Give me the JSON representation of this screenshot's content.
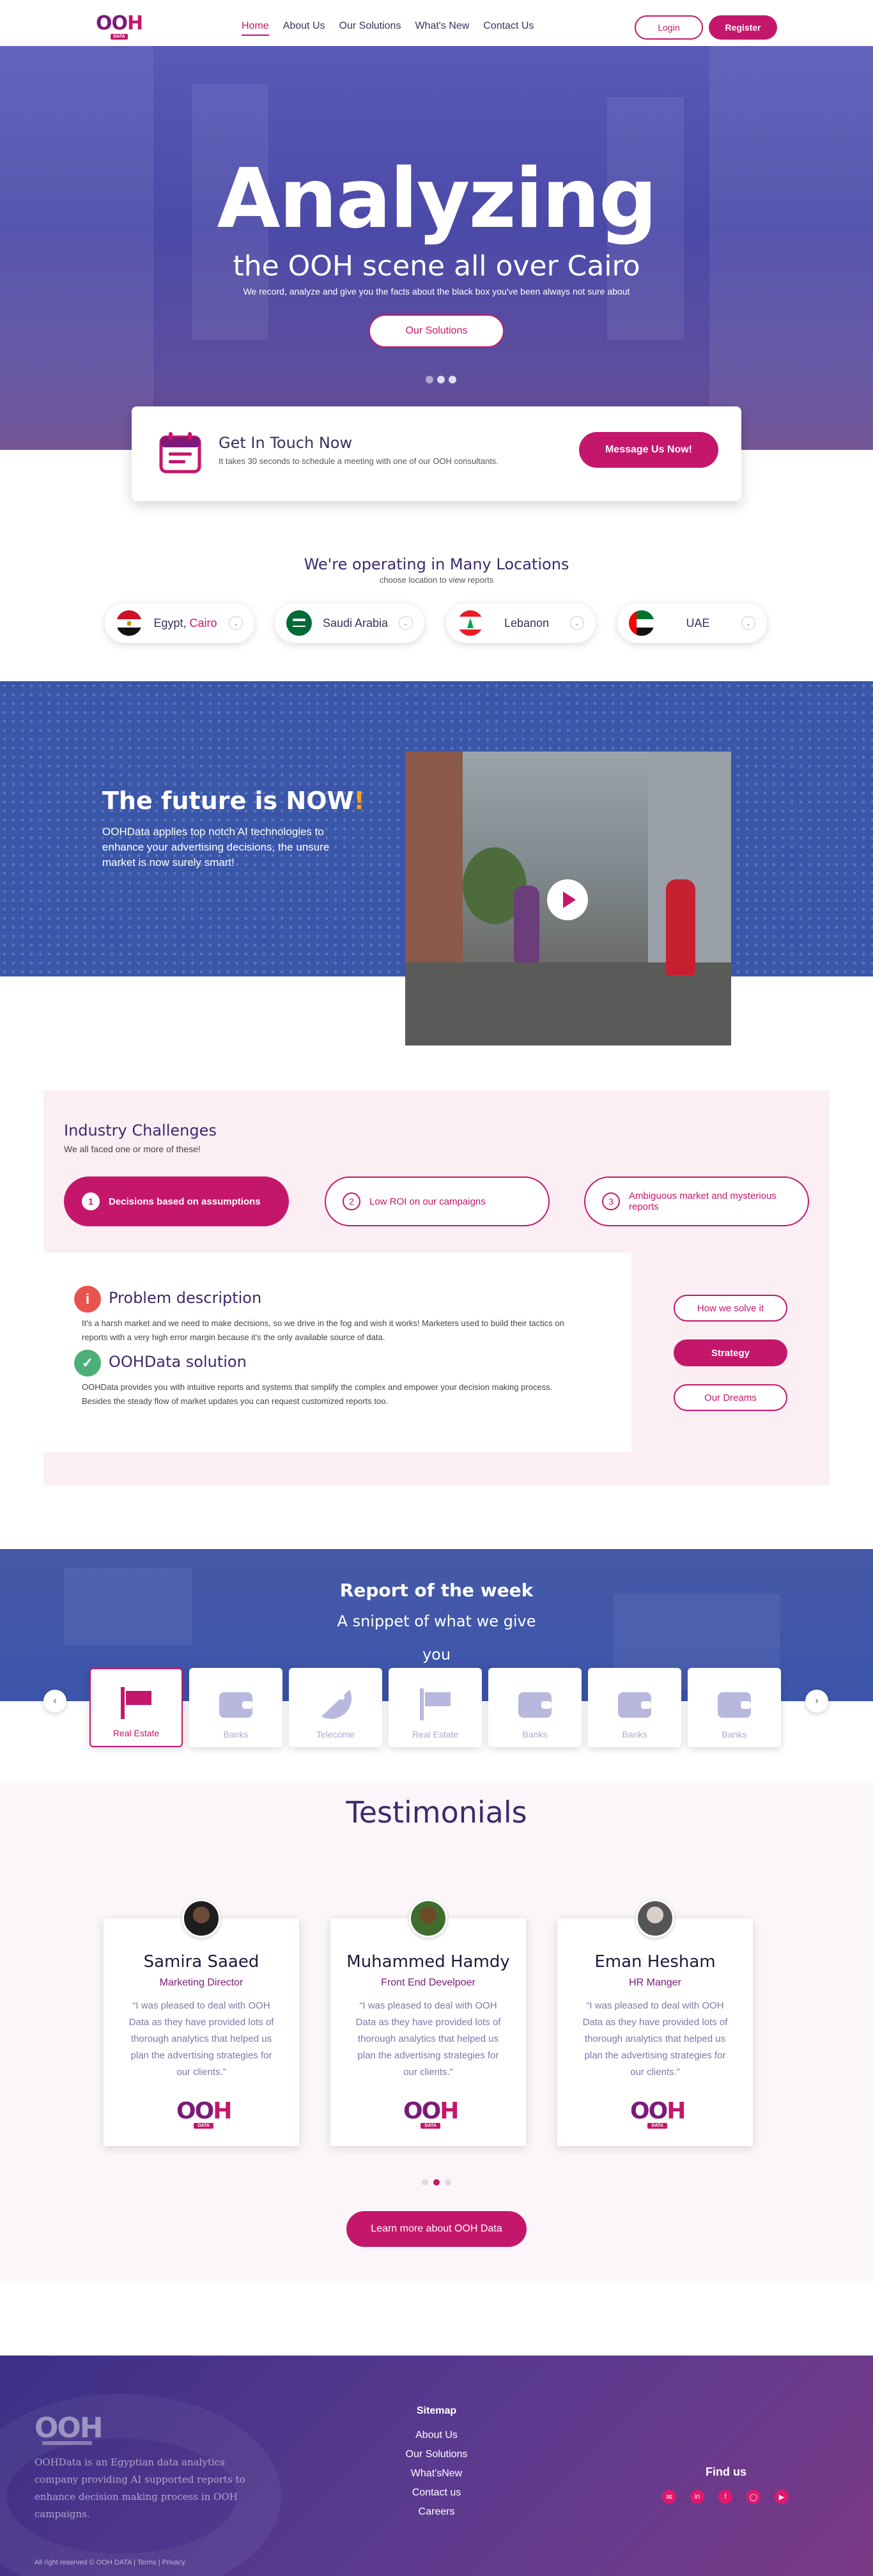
{
  "nav": {
    "logo_main": "OOH",
    "logo_sub": "DATA",
    "items": [
      "Home",
      "About Us",
      "Our Solutions",
      "What's New",
      "Contact Us"
    ],
    "active_index": 0,
    "login": "Login",
    "register": "Register"
  },
  "hero": {
    "title": "Analyzing",
    "subtitle": "the OOH scene all over Cairo",
    "text": "We record, analyze and give you the facts about the black box you've been always not sure about",
    "cta": "Our Solutions"
  },
  "touch": {
    "title": "Get In Touch Now",
    "text": "It takes 30 seconds to schedule a meeting with one of our OOH consultants.",
    "button": "Message Us Now!",
    "icon": "calendar-icon"
  },
  "locations": {
    "title": "We're operating in Many Locations",
    "subtitle": "choose location to view reports",
    "items": [
      {
        "label": "Egypt,",
        "city": "Cairo"
      },
      {
        "label": "Saudi Arabia",
        "city": ""
      },
      {
        "label": "Lebanon",
        "city": ""
      },
      {
        "label": "UAE",
        "city": ""
      }
    ]
  },
  "future": {
    "title": "The future is NOW",
    "exclaim": "!",
    "text": "OOHData applies top notch AI technologies to enhance your advertising decisions, the unsure market is now surely smart!"
  },
  "challenges": {
    "title": "Industry Challenges",
    "subtitle": "We all faced one or more of these!",
    "pills": [
      {
        "num": "1",
        "label": "Decisions based on assumptions"
      },
      {
        "num": "2",
        "label": "Low ROI on our campaigns"
      },
      {
        "num": "3",
        "label": "Ambiguous market and mysterious reports"
      }
    ],
    "problem_title": "Problem description",
    "problem_text": "It's a harsh market and we need to make decisions, so we drive in the fog and wish it works! Marketers used to build their tactics on reports with a very high error margin because it's the only available source of data.",
    "solution_title": "OOHData solution",
    "solution_text": "OOHData provides you with intuitive reports and systems that simplify the complex and empower your decision making process. Besides the steady flow of market updates you can request customized reports too.",
    "side_buttons": [
      "How we solve it",
      "Strategy",
      "Our Dreams"
    ]
  },
  "report": {
    "title": "Report of the week",
    "snippet": "A snippet of what we give",
    "snippet2": "you",
    "cards": [
      "Real Estate",
      "Banks",
      "Telecome",
      "Real Estate",
      "Banks",
      "Banks",
      "Banks"
    ]
  },
  "testimonials": {
    "title": "Testimonials",
    "items": [
      {
        "name": "Samira Saaed",
        "role": "Marketing Director",
        "quote": "“I was pleased to deal with OOH Data as they have provided lots of thorough analytics that helped us plan the advertising strategies for our clients.”"
      },
      {
        "name": "Muhammed Hamdy",
        "role": "Front End Develpoer",
        "quote": "“I was pleased to deal with OOH Data as they have provided lots of thorough analytics that helped us plan the advertising strategies for our clients.”"
      },
      {
        "name": "Eman Hesham",
        "role": "HR Manger",
        "quote": "“I was pleased to deal with OOH Data as they have provided lots of thorough analytics that helped us plan the advertising strategies for our clients.”"
      }
    ],
    "logo_main": "OOH",
    "logo_sub": "DATA",
    "learn": "Learn more about OOH Data"
  },
  "footer": {
    "logo": "OOH",
    "desc": "OOHData is an Egyptian data analytics company providing AI supported reports to enhance decision making process in OOH campaigns.",
    "copyright": "All right reserved © OOH DATA | Terms | Privacy",
    "sitemap_title": "Sitemap",
    "links": [
      "About Us",
      "Our Solutions",
      "What'sNew",
      "Contact us",
      "Careers"
    ],
    "find_us": "Find us",
    "social": [
      "mail-icon",
      "linkedin-icon",
      "facebook-icon",
      "instagram-icon",
      "youtube-icon"
    ]
  },
  "colors": {
    "brand": "#c4176b",
    "purple": "#7b1a7a",
    "blue": "#3a56a8"
  }
}
